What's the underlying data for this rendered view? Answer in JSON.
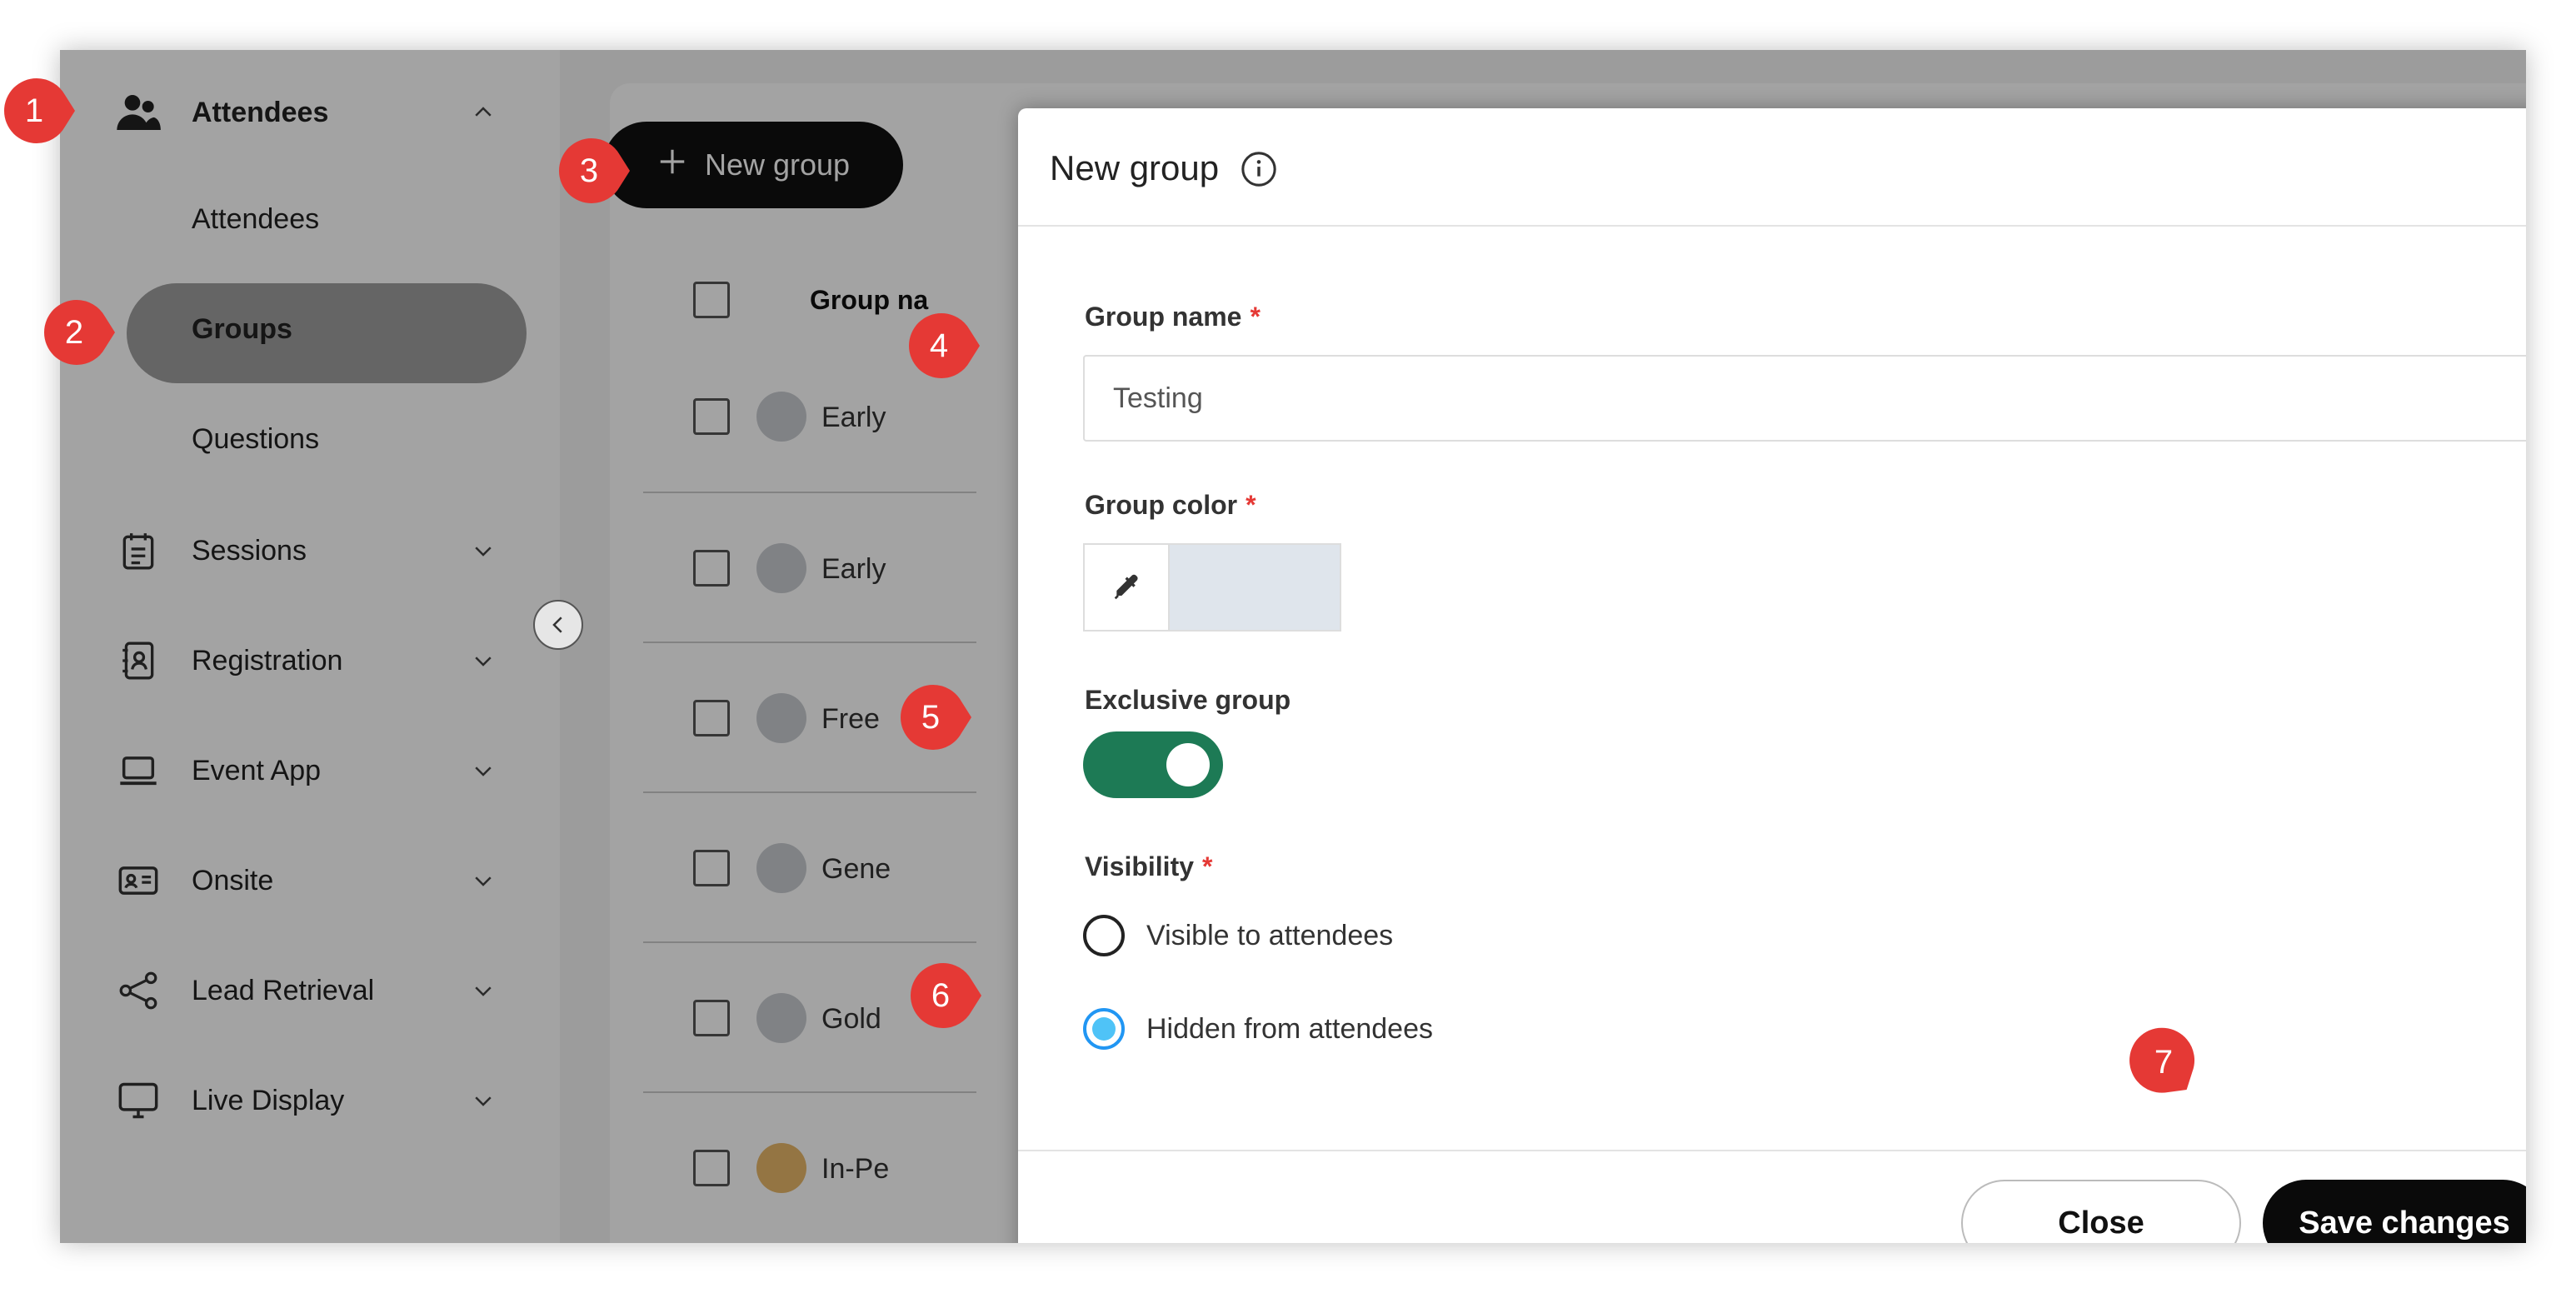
{
  "sidebar": {
    "attendees_section": {
      "label": "Attendees",
      "icon": "users-icon"
    },
    "sub_items": [
      {
        "label": "Attendees"
      },
      {
        "label": "Groups"
      },
      {
        "label": "Questions"
      }
    ],
    "nav_items": [
      {
        "label": "Sessions",
        "icon": "schedule-icon"
      },
      {
        "label": "Registration",
        "icon": "contact-book-icon"
      },
      {
        "label": "Event App",
        "icon": "laptop-icon"
      },
      {
        "label": "Onsite",
        "icon": "id-card-icon"
      },
      {
        "label": "Lead Retrieval",
        "icon": "share-icon"
      },
      {
        "label": "Live Display",
        "icon": "monitor-icon"
      }
    ]
  },
  "toolbar": {
    "new_group_label": "New group"
  },
  "table": {
    "header_label": "Group na",
    "rows": [
      {
        "name": "Early",
        "color": "#c8ccd0"
      },
      {
        "name": "Early",
        "color": "#c8ccd0"
      },
      {
        "name": "Free",
        "color": "#c8ccd0"
      },
      {
        "name": "Gene",
        "color": "#c8ccd0"
      },
      {
        "name": "Gold",
        "color": "#c8ccd0"
      },
      {
        "name": "In-Pe",
        "color": "#e8b86a"
      }
    ]
  },
  "modal": {
    "title": "New group",
    "close_symbol": "×",
    "group_name_label": "Group name",
    "group_name_value": "Testing",
    "group_color_label": "Group color",
    "group_color_value": "#dfe5ec",
    "exclusive_label": "Exclusive group",
    "exclusive_on": true,
    "visibility_label": "Visibility",
    "required_mark": "*",
    "visibility_options": [
      {
        "label": "Visible to attendees",
        "selected": false
      },
      {
        "label": "Hidden from attendees",
        "selected": true
      }
    ],
    "close_button": "Close",
    "save_button": "Save changes"
  },
  "callouts": [
    "1",
    "2",
    "3",
    "4",
    "5",
    "6",
    "7"
  ],
  "colors": {
    "toggle_on": "#1d7a55",
    "callout": "#e53935",
    "radio_selected": "#4fc3f7"
  }
}
